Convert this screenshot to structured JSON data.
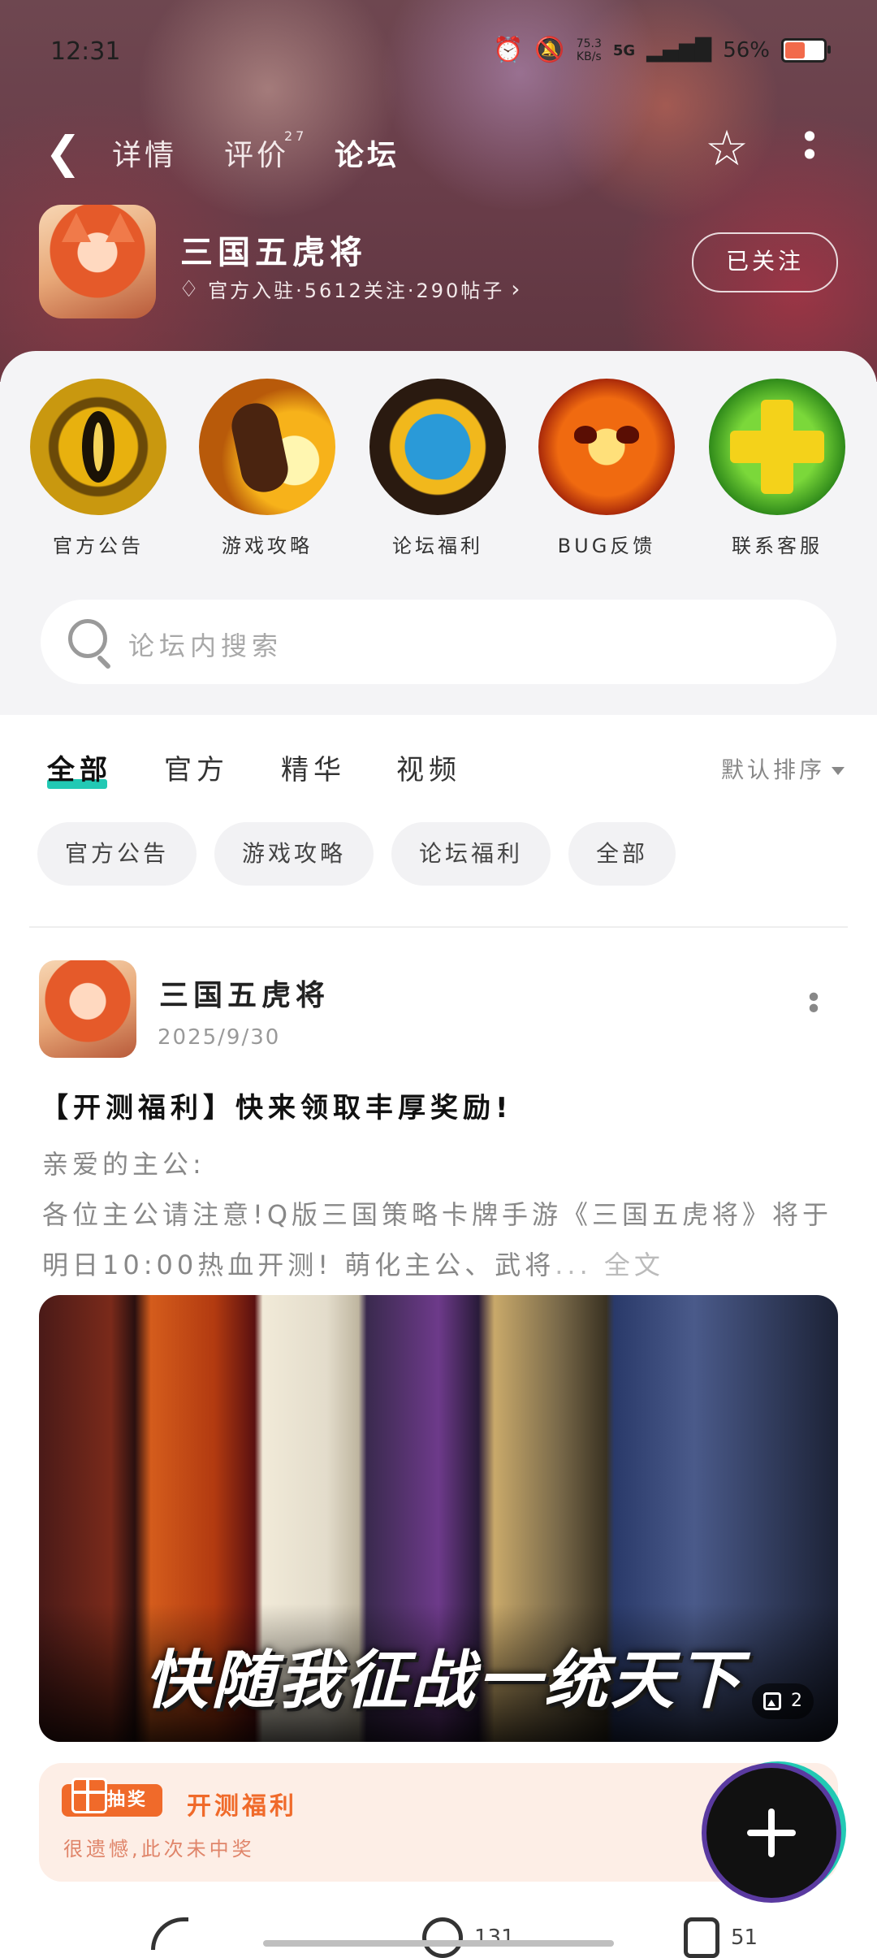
{
  "status": {
    "time": "12:31",
    "net_speed_value": "75.3",
    "net_speed_unit": "KB/s",
    "network": "5G",
    "battery": "56%",
    "battery_level": 0.56
  },
  "nav": {
    "tabs": [
      {
        "label": "详情"
      },
      {
        "label": "评价",
        "badge": "27"
      },
      {
        "label": "论坛",
        "active": true
      }
    ]
  },
  "game": {
    "title": "三国五虎将",
    "meta": "官方入驻·5612关注·290帖子",
    "follow_label": "已关注"
  },
  "quick_links": [
    {
      "label": "官方公告",
      "icon": "eye-emblem-icon"
    },
    {
      "label": "游戏攻略",
      "icon": "fist-emblem-icon"
    },
    {
      "label": "论坛福利",
      "icon": "gift-emblem-icon"
    },
    {
      "label": "BUG反馈",
      "icon": "pumpkin-emblem-icon"
    },
    {
      "label": "联系客服",
      "icon": "plus-emblem-icon"
    }
  ],
  "search": {
    "placeholder": "论坛内搜索"
  },
  "filter_tabs": [
    {
      "label": "全部",
      "active": true
    },
    {
      "label": "官方"
    },
    {
      "label": "精华"
    },
    {
      "label": "视频"
    }
  ],
  "sort_label": "默认排序",
  "chips": [
    "官方公告",
    "游戏攻略",
    "论坛福利",
    "全部"
  ],
  "post": {
    "author": "三国五虎将",
    "date": "2025/9/30",
    "title": "【开测福利】快来领取丰厚奖励!",
    "greeting": "亲爱的主公:",
    "excerpt": " 各位主公请注意!Q版三国策略卡牌手游《三国五虎将》将于明日10:00热血开测! 萌化主公、武将",
    "ellipsis": "...",
    "more_label": "全文",
    "image_caption": "快随我征战一统天下",
    "image_count": "2"
  },
  "lottery": {
    "badge": "抽奖",
    "title": "开测福利",
    "subtitle": "很遗憾,此次未中奖"
  },
  "actions": {
    "comments": "131",
    "likes": "51"
  },
  "colors": {
    "accent": "#22c9b4",
    "lottery_orange": "#f06a2a"
  }
}
